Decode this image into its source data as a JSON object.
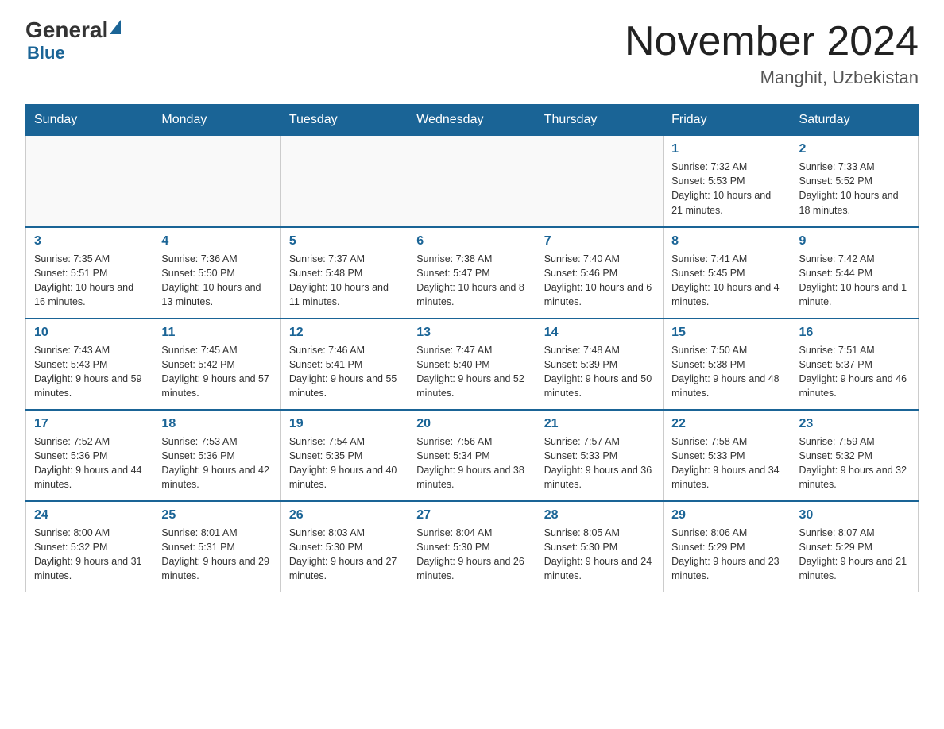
{
  "header": {
    "logo_general": "General",
    "logo_blue": "Blue",
    "month_title": "November 2024",
    "location": "Manghit, Uzbekistan"
  },
  "weekdays": [
    "Sunday",
    "Monday",
    "Tuesday",
    "Wednesday",
    "Thursday",
    "Friday",
    "Saturday"
  ],
  "weeks": [
    [
      {
        "day": "",
        "info": ""
      },
      {
        "day": "",
        "info": ""
      },
      {
        "day": "",
        "info": ""
      },
      {
        "day": "",
        "info": ""
      },
      {
        "day": "",
        "info": ""
      },
      {
        "day": "1",
        "info": "Sunrise: 7:32 AM\nSunset: 5:53 PM\nDaylight: 10 hours and 21 minutes."
      },
      {
        "day": "2",
        "info": "Sunrise: 7:33 AM\nSunset: 5:52 PM\nDaylight: 10 hours and 18 minutes."
      }
    ],
    [
      {
        "day": "3",
        "info": "Sunrise: 7:35 AM\nSunset: 5:51 PM\nDaylight: 10 hours and 16 minutes."
      },
      {
        "day": "4",
        "info": "Sunrise: 7:36 AM\nSunset: 5:50 PM\nDaylight: 10 hours and 13 minutes."
      },
      {
        "day": "5",
        "info": "Sunrise: 7:37 AM\nSunset: 5:48 PM\nDaylight: 10 hours and 11 minutes."
      },
      {
        "day": "6",
        "info": "Sunrise: 7:38 AM\nSunset: 5:47 PM\nDaylight: 10 hours and 8 minutes."
      },
      {
        "day": "7",
        "info": "Sunrise: 7:40 AM\nSunset: 5:46 PM\nDaylight: 10 hours and 6 minutes."
      },
      {
        "day": "8",
        "info": "Sunrise: 7:41 AM\nSunset: 5:45 PM\nDaylight: 10 hours and 4 minutes."
      },
      {
        "day": "9",
        "info": "Sunrise: 7:42 AM\nSunset: 5:44 PM\nDaylight: 10 hours and 1 minute."
      }
    ],
    [
      {
        "day": "10",
        "info": "Sunrise: 7:43 AM\nSunset: 5:43 PM\nDaylight: 9 hours and 59 minutes."
      },
      {
        "day": "11",
        "info": "Sunrise: 7:45 AM\nSunset: 5:42 PM\nDaylight: 9 hours and 57 minutes."
      },
      {
        "day": "12",
        "info": "Sunrise: 7:46 AM\nSunset: 5:41 PM\nDaylight: 9 hours and 55 minutes."
      },
      {
        "day": "13",
        "info": "Sunrise: 7:47 AM\nSunset: 5:40 PM\nDaylight: 9 hours and 52 minutes."
      },
      {
        "day": "14",
        "info": "Sunrise: 7:48 AM\nSunset: 5:39 PM\nDaylight: 9 hours and 50 minutes."
      },
      {
        "day": "15",
        "info": "Sunrise: 7:50 AM\nSunset: 5:38 PM\nDaylight: 9 hours and 48 minutes."
      },
      {
        "day": "16",
        "info": "Sunrise: 7:51 AM\nSunset: 5:37 PM\nDaylight: 9 hours and 46 minutes."
      }
    ],
    [
      {
        "day": "17",
        "info": "Sunrise: 7:52 AM\nSunset: 5:36 PM\nDaylight: 9 hours and 44 minutes."
      },
      {
        "day": "18",
        "info": "Sunrise: 7:53 AM\nSunset: 5:36 PM\nDaylight: 9 hours and 42 minutes."
      },
      {
        "day": "19",
        "info": "Sunrise: 7:54 AM\nSunset: 5:35 PM\nDaylight: 9 hours and 40 minutes."
      },
      {
        "day": "20",
        "info": "Sunrise: 7:56 AM\nSunset: 5:34 PM\nDaylight: 9 hours and 38 minutes."
      },
      {
        "day": "21",
        "info": "Sunrise: 7:57 AM\nSunset: 5:33 PM\nDaylight: 9 hours and 36 minutes."
      },
      {
        "day": "22",
        "info": "Sunrise: 7:58 AM\nSunset: 5:33 PM\nDaylight: 9 hours and 34 minutes."
      },
      {
        "day": "23",
        "info": "Sunrise: 7:59 AM\nSunset: 5:32 PM\nDaylight: 9 hours and 32 minutes."
      }
    ],
    [
      {
        "day": "24",
        "info": "Sunrise: 8:00 AM\nSunset: 5:32 PM\nDaylight: 9 hours and 31 minutes."
      },
      {
        "day": "25",
        "info": "Sunrise: 8:01 AM\nSunset: 5:31 PM\nDaylight: 9 hours and 29 minutes."
      },
      {
        "day": "26",
        "info": "Sunrise: 8:03 AM\nSunset: 5:30 PM\nDaylight: 9 hours and 27 minutes."
      },
      {
        "day": "27",
        "info": "Sunrise: 8:04 AM\nSunset: 5:30 PM\nDaylight: 9 hours and 26 minutes."
      },
      {
        "day": "28",
        "info": "Sunrise: 8:05 AM\nSunset: 5:30 PM\nDaylight: 9 hours and 24 minutes."
      },
      {
        "day": "29",
        "info": "Sunrise: 8:06 AM\nSunset: 5:29 PM\nDaylight: 9 hours and 23 minutes."
      },
      {
        "day": "30",
        "info": "Sunrise: 8:07 AM\nSunset: 5:29 PM\nDaylight: 9 hours and 21 minutes."
      }
    ]
  ]
}
